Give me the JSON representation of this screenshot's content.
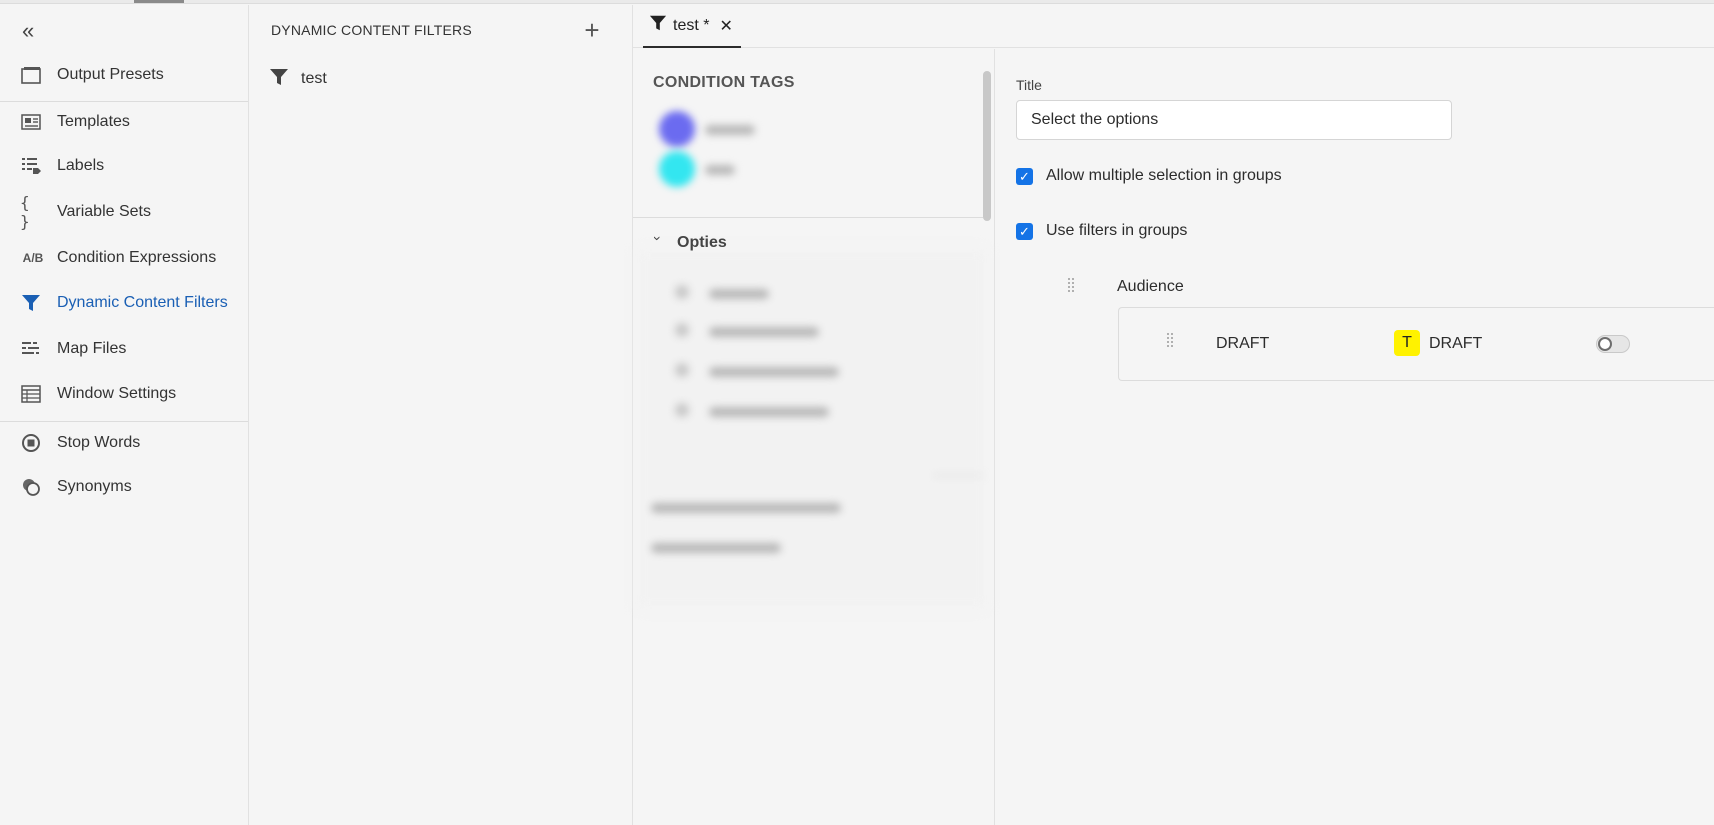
{
  "nav": {
    "items": [
      {
        "label": "Output Presets",
        "icon": "window-icon"
      },
      {
        "label": "Templates",
        "icon": "template-icon"
      },
      {
        "label": "Labels",
        "icon": "labels-icon"
      },
      {
        "label": "Variable Sets",
        "icon": "braces-icon",
        "glyph": "{ }"
      },
      {
        "label": "Condition Expressions",
        "icon": "ab-icon",
        "glyph": "A/B"
      },
      {
        "label": "Dynamic Content Filters",
        "icon": "filter-icon",
        "active": true
      },
      {
        "label": "Map Files",
        "icon": "map-files-icon"
      },
      {
        "label": "Window Settings",
        "icon": "table-icon"
      },
      {
        "label": "Stop Words",
        "icon": "stop-icon"
      },
      {
        "label": "Synonyms",
        "icon": "synonyms-icon"
      }
    ],
    "collapse_glyph": "«"
  },
  "filters": {
    "heading": "DYNAMIC CONTENT FILTERS",
    "add_glyph": "+",
    "items": [
      {
        "label": "test"
      }
    ]
  },
  "tab": {
    "label": "test *",
    "close_glyph": "✕"
  },
  "conditions": {
    "heading": "CONDITION TAGS",
    "group_label": "Opties",
    "group_chevron": "›",
    "tag_colors": [
      "#6b6bf0",
      "#33e6f0"
    ]
  },
  "detail": {
    "title_label": "Title",
    "title_value": "Select the options",
    "allow_multiple_label": "Allow multiple selection in groups",
    "use_filters_label": "Use filters in groups",
    "checkmark": "✓",
    "group_name": "Audience",
    "rows": [
      {
        "name": "DRAFT",
        "tag_badge": "T",
        "tag_label": "DRAFT",
        "tag_color": "#fff200",
        "enabled": false
      }
    ]
  }
}
